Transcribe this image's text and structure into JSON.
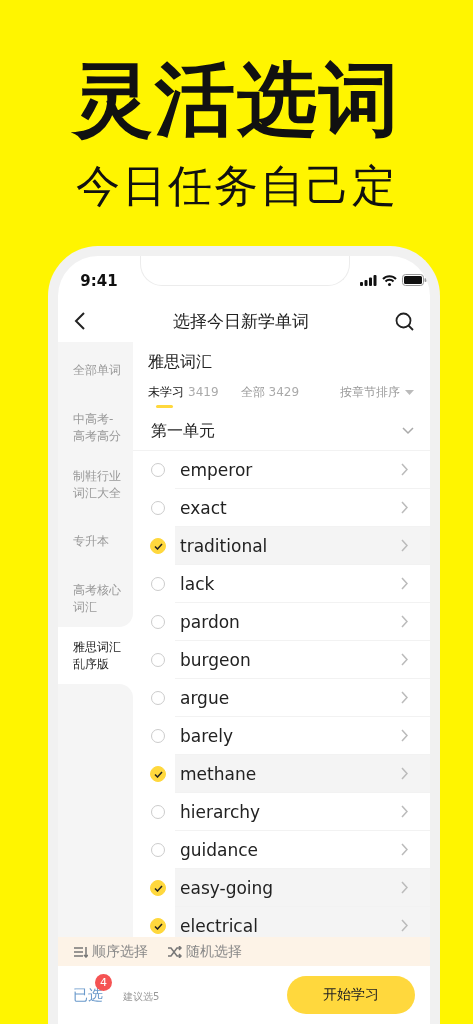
{
  "headline": "灵活选词",
  "subtitle": "今日任务自己定",
  "status_bar": {
    "time": "9:41"
  },
  "nav": {
    "title": "选择今日新学单词"
  },
  "sidebar": {
    "items": [
      {
        "label": "全部单词",
        "selected": false
      },
      {
        "label": "中高考-高考高分",
        "selected": false
      },
      {
        "label": "制鞋行业词汇大全",
        "selected": false
      },
      {
        "label": "专升本",
        "selected": false
      },
      {
        "label": "高考核心词汇",
        "selected": false
      },
      {
        "label": "雅思词汇乱序版",
        "selected": true
      }
    ]
  },
  "content": {
    "title": "雅思词汇",
    "filters": [
      {
        "label": "未学习",
        "count": "3419",
        "selected": true
      },
      {
        "label": "全部",
        "count": "3429",
        "selected": false
      }
    ],
    "sort": "按章节排序",
    "unit": {
      "label": "第一单元",
      "expanded": true
    },
    "words": [
      {
        "word": "emperor",
        "checked": false
      },
      {
        "word": "exact",
        "checked": false
      },
      {
        "word": "traditional",
        "checked": true
      },
      {
        "word": "lack",
        "checked": false
      },
      {
        "word": "pardon",
        "checked": false
      },
      {
        "word": "burgeon",
        "checked": false
      },
      {
        "word": "argue",
        "checked": false
      },
      {
        "word": "barely",
        "checked": false
      },
      {
        "word": "methane",
        "checked": true
      },
      {
        "word": "hierarchy",
        "checked": false
      },
      {
        "word": "guidance",
        "checked": false
      },
      {
        "word": "easy-going",
        "checked": true
      },
      {
        "word": "electrical",
        "checked": true
      }
    ]
  },
  "actions": [
    {
      "kind": "sequential",
      "label": "顺序选择"
    },
    {
      "kind": "random",
      "label": "随机选择"
    }
  ],
  "footer": {
    "selected_label": "已选",
    "badge": "4",
    "hint": "建议选5",
    "start_button": "开始学习"
  }
}
